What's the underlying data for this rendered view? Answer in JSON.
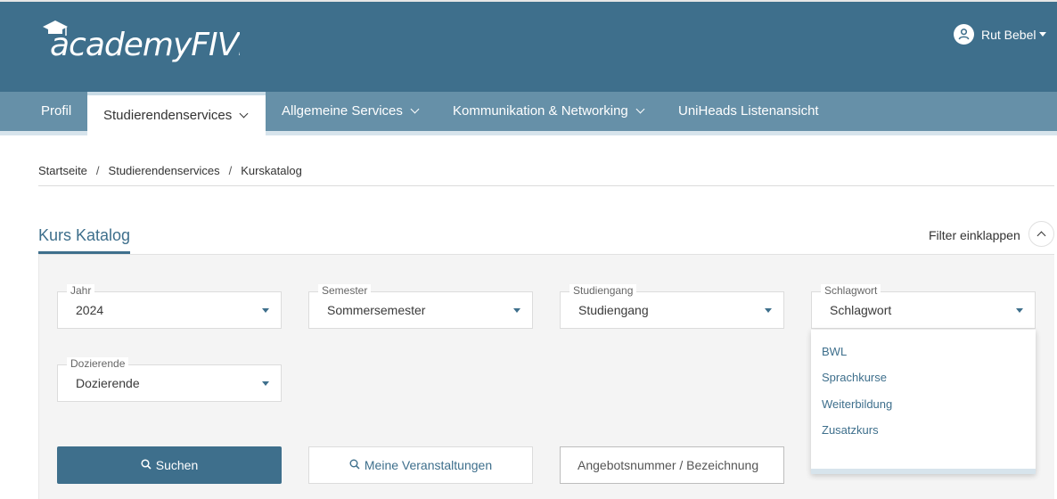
{
  "header": {
    "logo_text": "academyFIVE",
    "user_name": "Rut Bebel"
  },
  "nav": {
    "items": [
      {
        "label": "Profil"
      },
      {
        "label": "Studierendenservices"
      },
      {
        "label": "Allgemeine Services"
      },
      {
        "label": "Kommunikation & Networking"
      },
      {
        "label": "UniHeads Listenansicht"
      }
    ]
  },
  "breadcrumb": {
    "items": [
      "Startseite",
      "Studierendenservices",
      "Kurskatalog"
    ],
    "separator": "/"
  },
  "page": {
    "title": "Kurs Katalog",
    "filter_toggle_label": "Filter einklappen"
  },
  "filters": {
    "jahr": {
      "label": "Jahr",
      "value": "2024"
    },
    "semester": {
      "label": "Semester",
      "value": "Sommersemester"
    },
    "studiengang": {
      "label": "Studiengang",
      "value": "Studiengang"
    },
    "schlagwort": {
      "label": "Schlagwort",
      "value": "Schlagwort"
    },
    "dozierende": {
      "label": "Dozierende",
      "value": "Dozierende"
    }
  },
  "dropdown": {
    "options": [
      "BWL",
      "Sprachkurse",
      "Weiterbildung",
      "Zusatzkurs"
    ]
  },
  "actions": {
    "search_label": "Suchen",
    "my_courses_label": "Meine Veranstaltungen",
    "search_input_placeholder": "Angebotsnummer / Bezeichnung"
  },
  "colors": {
    "brand": "#3e6f8c",
    "nav": "#6690a8"
  }
}
